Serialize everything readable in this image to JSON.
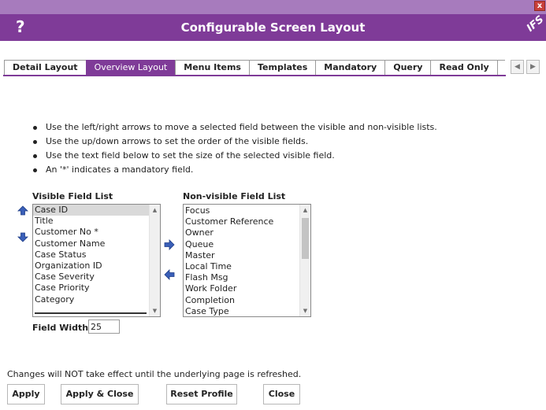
{
  "window": {
    "close_glyph": "x"
  },
  "header": {
    "help_glyph": "?",
    "title": "Configurable Screen Layout",
    "logo_text": "IFS",
    "bg_color": "#7f3b98"
  },
  "tabs": [
    {
      "label": "Detail Layout",
      "active": false
    },
    {
      "label": "Overview Layout",
      "active": true
    },
    {
      "label": "Menu Items",
      "active": false
    },
    {
      "label": "Templates",
      "active": false
    },
    {
      "label": "Mandatory",
      "active": false
    },
    {
      "label": "Query",
      "active": false
    },
    {
      "label": "Read Only",
      "active": false
    },
    {
      "label": "I",
      "active": false
    }
  ],
  "tab_scroll": {
    "left_glyph": "◀",
    "right_glyph": "▶"
  },
  "instructions": [
    "Use the left/right arrows to move a selected field between the visible and non-visible lists.",
    "Use the up/down arrows to set the order of the visible fields.",
    "Use the text field below to set the size of the selected visible field.",
    "An '*' indicates a mandatory field."
  ],
  "visible_list": {
    "label": "Visible Field List",
    "items": [
      "Case ID",
      "Title",
      "Customer No *",
      "Customer Name",
      "Case Status",
      "Organization ID",
      "Case Severity",
      "Case Priority",
      "Category"
    ],
    "selected": "Case ID"
  },
  "nonvisible_list": {
    "label": "Non-visible Field List",
    "items": [
      "Focus",
      "Customer Reference",
      "Owner",
      "Queue",
      "Master",
      "Local Time",
      "Flash Msg",
      "Work Folder",
      "Completion",
      "Case Type"
    ]
  },
  "field_width": {
    "label": "Field Width",
    "value": "25"
  },
  "note": "Changes will NOT take effect until the underlying page is refreshed.",
  "buttons": {
    "apply": "Apply",
    "apply_close": "Apply & Close",
    "reset": "Reset Profile",
    "close": "Close"
  },
  "colors": {
    "accent": "#7f3b98",
    "arrow_blue": "#3a5fb8"
  }
}
